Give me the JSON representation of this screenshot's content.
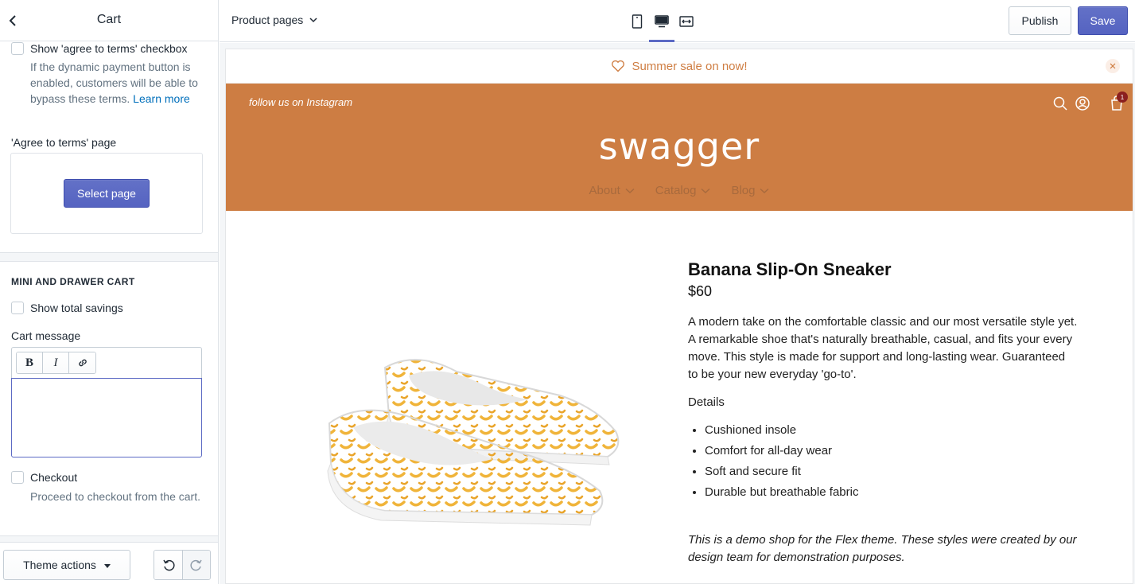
{
  "sidebar": {
    "title": "Cart",
    "agree_terms": {
      "label": "Show 'agree to terms' checkbox",
      "help": "If the dynamic payment button is enabled, customers will be able to bypass these terms.",
      "learn_more": "Learn more"
    },
    "terms_page": {
      "label": "'Agree to terms' page",
      "button": "Select page"
    },
    "mini_cart": {
      "heading": "MINI AND DRAWER CART",
      "show_savings": "Show total savings",
      "cart_message_label": "Cart message",
      "cart_message_value": "",
      "checkout_label": "Checkout",
      "checkout_help": "Proceed to checkout from the cart."
    },
    "footer": {
      "theme_actions": "Theme actions"
    }
  },
  "topbar": {
    "page_select": "Product pages",
    "publish": "Publish",
    "save": "Save",
    "active_view": "desktop"
  },
  "preview": {
    "announcement": "Summer sale on now!",
    "instagram": "follow us on Instagram",
    "logo": "swagger",
    "cart_count": "1",
    "nav": [
      "About",
      "Catalog",
      "Blog"
    ],
    "product": {
      "title": "Banana Slip-On Sneaker",
      "price": "$60",
      "description": "A modern take on the comfortable classic and our most versatile style yet. A remarkable shoe that's naturally breathable, casual, and fits your every move. This style is made for support and long-lasting wear. Guaranteed to be your new everyday 'go-to'.",
      "details_heading": "Details",
      "details": [
        "Cushioned insole",
        "Comfort for all-day wear",
        "Soft and secure fit",
        "Durable but breathable fabric"
      ],
      "note": "This is a demo shop for the Flex theme. These styles were created by our design team for demonstration purposes."
    }
  },
  "colors": {
    "accent": "#5c6ac4",
    "header_bg": "#cd7d43",
    "announcement_text": "#cf7e43"
  }
}
